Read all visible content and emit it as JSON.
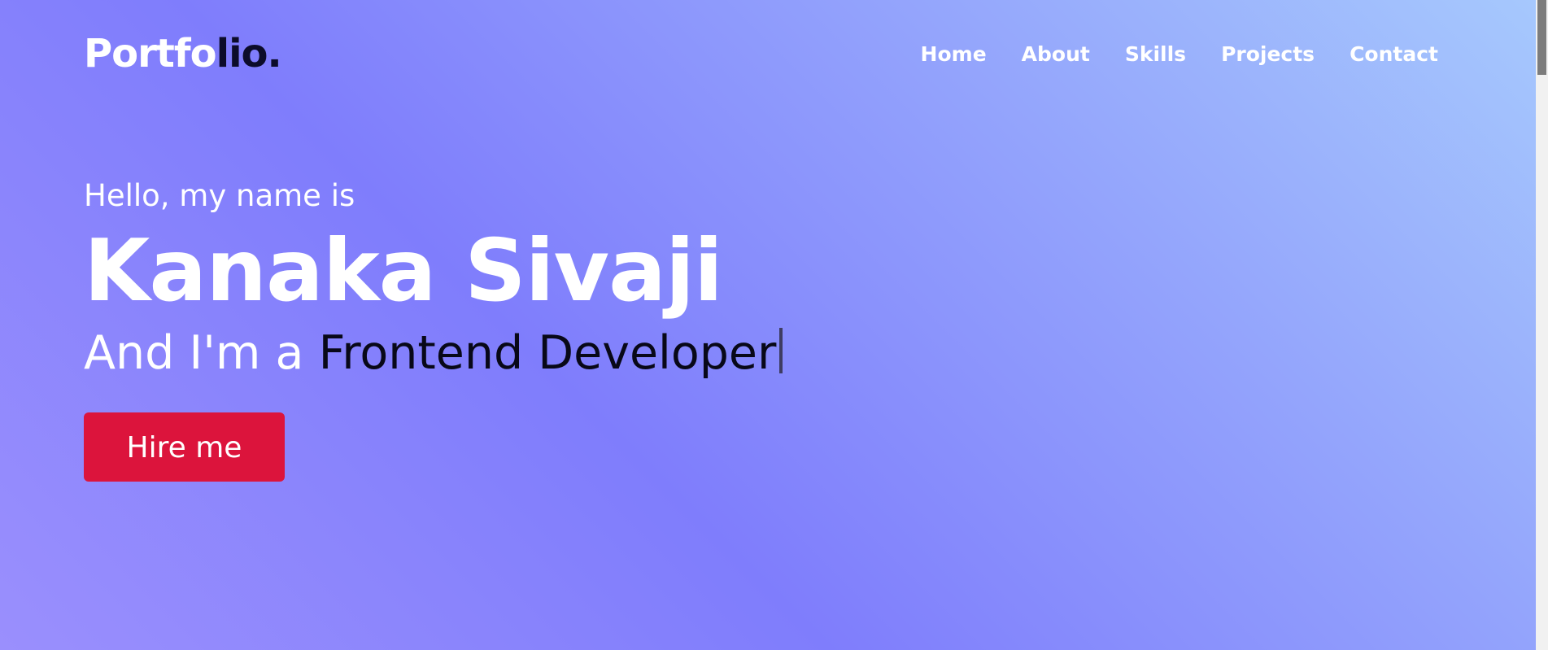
{
  "logo": {
    "part_light": "Portfo",
    "part_dark": "lio."
  },
  "nav": {
    "items": [
      "Home",
      "About",
      "Skills",
      "Projects",
      "Contact"
    ]
  },
  "hero": {
    "greeting": "Hello, my name is",
    "name": "Kanaka Sivaji",
    "role_prefix": "And I'm a",
    "role_typed": "Frontend Developer",
    "cta_label": "Hire me"
  },
  "colors": {
    "gradient_light": "#a6c8fd",
    "gradient_mid": "#93a3fc",
    "gradient_deep": "#7f7dfc",
    "cta_background": "#dc143c",
    "logo_dark": "#0c0c2a"
  }
}
